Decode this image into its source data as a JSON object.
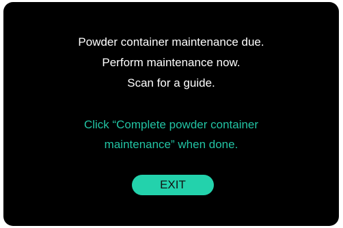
{
  "dialog": {
    "message_lines": [
      "Powder container maintenance due.",
      "Perform maintenance now.",
      "Scan for a guide."
    ],
    "hint_lines": [
      "Click “Complete powder container",
      "maintenance” when done."
    ],
    "exit_label": "EXIT"
  },
  "colors": {
    "background": "#000000",
    "text": "#ffffff",
    "accent": "#23d2ac",
    "hint_text": "#22c4a4"
  }
}
